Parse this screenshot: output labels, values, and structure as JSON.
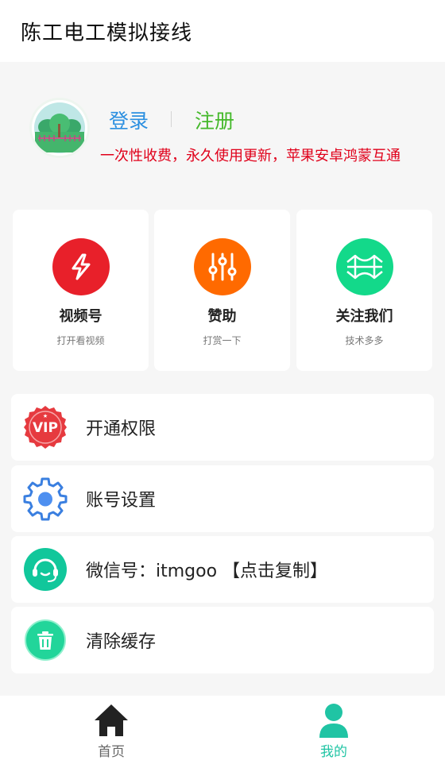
{
  "header": {
    "title": "陈工电工模拟接线"
  },
  "profile": {
    "login_label": "登录",
    "register_label": "注册",
    "promo_text": "一次性收费，永久使用更新，苹果安卓鸿蒙互通"
  },
  "cards": [
    {
      "title": "视频号",
      "subtitle": "打开看视频",
      "icon": "lightning-icon",
      "color": "#e8202a"
    },
    {
      "title": "赞助",
      "subtitle": "打赏一下",
      "icon": "sliders-icon",
      "color": "#ff6a00"
    },
    {
      "title": "关注我们",
      "subtitle": "技术多多",
      "icon": "bridge-icon",
      "color": "#13d98a"
    }
  ],
  "menu": [
    {
      "label": "开通权限",
      "icon": "vip-badge-icon"
    },
    {
      "label": "账号设置",
      "icon": "gear-icon"
    },
    {
      "label": "微信号：itmgoo 【点击复制】",
      "icon": "headset-icon"
    },
    {
      "label": "清除缓存",
      "icon": "trash-icon"
    }
  ],
  "tabbar": {
    "home_label": "首页",
    "mine_label": "我的",
    "active_color": "#20c4a4"
  }
}
